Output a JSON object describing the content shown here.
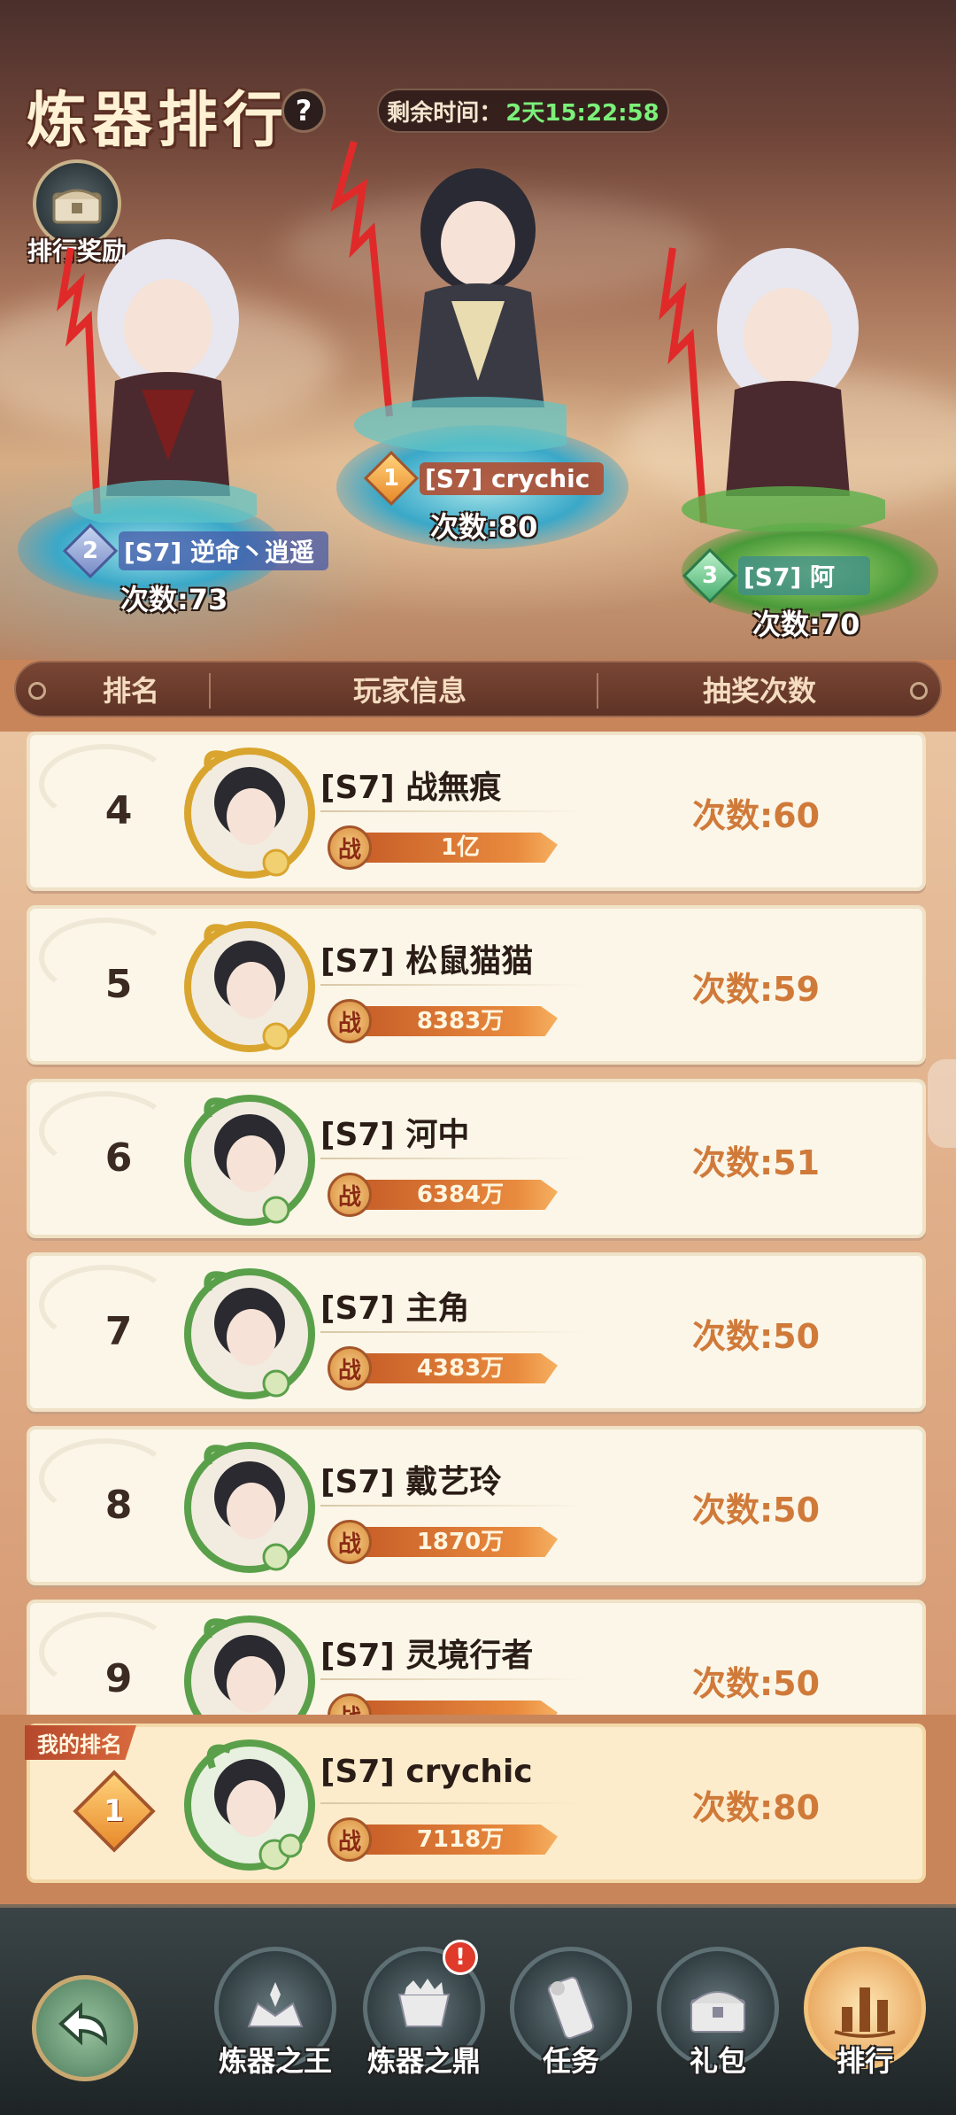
{
  "header": {
    "title": "炼器排行",
    "help_label": "?",
    "timer_label": "剩余时间：",
    "timer_value": "2天15:22:58",
    "reward_label": "排行奖励"
  },
  "podium": [
    {
      "rank": "1",
      "name": "[S7] crychic",
      "count": "次数:80"
    },
    {
      "rank": "2",
      "name": "[S7] 逆命丶逍遥",
      "count": "次数:73"
    },
    {
      "rank": "3",
      "name": "[S7] 阿",
      "count": "次数:70"
    }
  ],
  "table_header": {
    "rank": "排名",
    "player": "玩家信息",
    "draws": "抽奖次数"
  },
  "list": [
    {
      "rank": "4",
      "name": "[S7] 战無痕",
      "power_icon": "战",
      "power": "1亿",
      "count": "次数:60",
      "frame": "gold"
    },
    {
      "rank": "5",
      "name": "[S7] 松鼠猫猫",
      "power_icon": "战",
      "power": "8383万",
      "count": "次数:59",
      "frame": "gold"
    },
    {
      "rank": "6",
      "name": "[S7] 河中",
      "power_icon": "战",
      "power": "6384万",
      "count": "次数:51",
      "frame": "green"
    },
    {
      "rank": "7",
      "name": "[S7] 主角",
      "power_icon": "战",
      "power": "4383万",
      "count": "次数:50",
      "frame": "green"
    },
    {
      "rank": "8",
      "name": "[S7] 戴艺玲",
      "power_icon": "战",
      "power": "1870万",
      "count": "次数:50",
      "frame": "green"
    },
    {
      "rank": "9",
      "name": "[S7] 灵境行者",
      "power_icon": "战",
      "power": "",
      "count": "次数:50",
      "frame": "green"
    }
  ],
  "my_rank": {
    "tag": "我的排名",
    "rank": "1",
    "name": "[S7] crychic",
    "power_icon": "战",
    "power": "7118万",
    "count": "次数:80"
  },
  "bottom_nav": [
    {
      "label": "炼器之王",
      "icon": "crown-icon",
      "badge": ""
    },
    {
      "label": "炼器之鼎",
      "icon": "cauldron-icon",
      "badge": "!"
    },
    {
      "label": "任务",
      "icon": "scroll-icon",
      "badge": ""
    },
    {
      "label": "礼包",
      "icon": "chest-icon",
      "badge": ""
    },
    {
      "label": "排行",
      "icon": "bar-chart-icon",
      "badge": "",
      "active": true
    }
  ],
  "colors": {
    "accent_count": "#d07a3a",
    "timer_green": "#7cf07a",
    "gold_frame": "#d9a52e",
    "green_frame": "#5aa04a"
  }
}
